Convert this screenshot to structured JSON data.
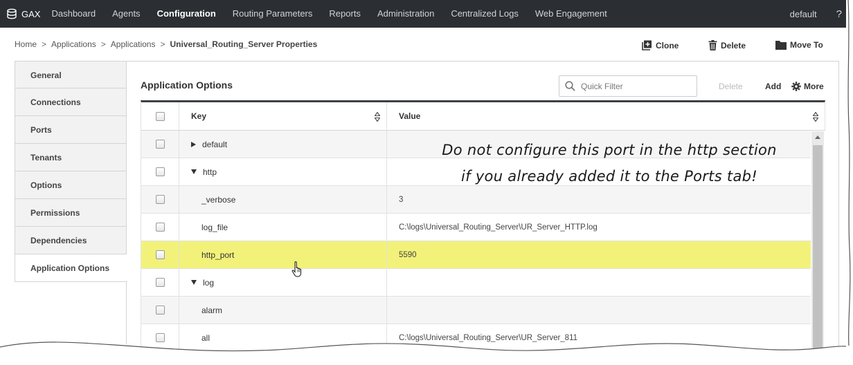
{
  "app": {
    "name": "GAX"
  },
  "nav": {
    "items": [
      "Dashboard",
      "Agents",
      "Configuration",
      "Routing Parameters",
      "Reports",
      "Administration",
      "Centralized Logs",
      "Web Engagement"
    ],
    "active": "Configuration",
    "user": "default",
    "help": "?"
  },
  "breadcrumb": {
    "items": [
      "Home",
      "Applications",
      "Applications"
    ],
    "current": "Universal_Routing_Server Properties",
    "separator": ">"
  },
  "actions": {
    "clone": "Clone",
    "delete": "Delete",
    "move_to": "Move To"
  },
  "side_tabs": [
    "General",
    "Connections",
    "Ports",
    "Tenants",
    "Options",
    "Permissions",
    "Dependencies",
    "Application Options"
  ],
  "side_tab_active": "Application Options",
  "panel": {
    "title": "Application Options",
    "filter_placeholder": "Quick Filter",
    "delete_label": "Delete",
    "add_label": "Add",
    "more_label": "More"
  },
  "table": {
    "columns": [
      "Key",
      "Value"
    ],
    "rows": [
      {
        "key": "default",
        "value": "",
        "level": 0,
        "expander": "collapsed"
      },
      {
        "key": "http",
        "value": "",
        "level": 0,
        "expander": "expanded"
      },
      {
        "key": "_verbose",
        "value": "3",
        "level": 1,
        "expander": "none"
      },
      {
        "key": "log_file",
        "value": "C:\\logs\\Universal_Routing_Server\\UR_Server_HTTP.log",
        "level": 1,
        "expander": "none"
      },
      {
        "key": "http_port",
        "value": "5590",
        "level": 1,
        "expander": "none",
        "highlighted": true
      },
      {
        "key": "log",
        "value": "",
        "level": 0,
        "expander": "expanded"
      },
      {
        "key": "alarm",
        "value": "",
        "level": 1,
        "expander": "none"
      },
      {
        "key": "all",
        "value": "C:\\logs\\Universal_Routing_Server\\UR_Server_811",
        "level": 1,
        "expander": "none"
      }
    ]
  },
  "annotation": {
    "line1": "Do not configure this port in the http section",
    "line2": "if you already added it to the Ports tab!"
  },
  "colors": {
    "nav_bg": "#2b2f33",
    "highlight_row": "#f2f27a",
    "table_header_rule": "#3b3f44"
  }
}
